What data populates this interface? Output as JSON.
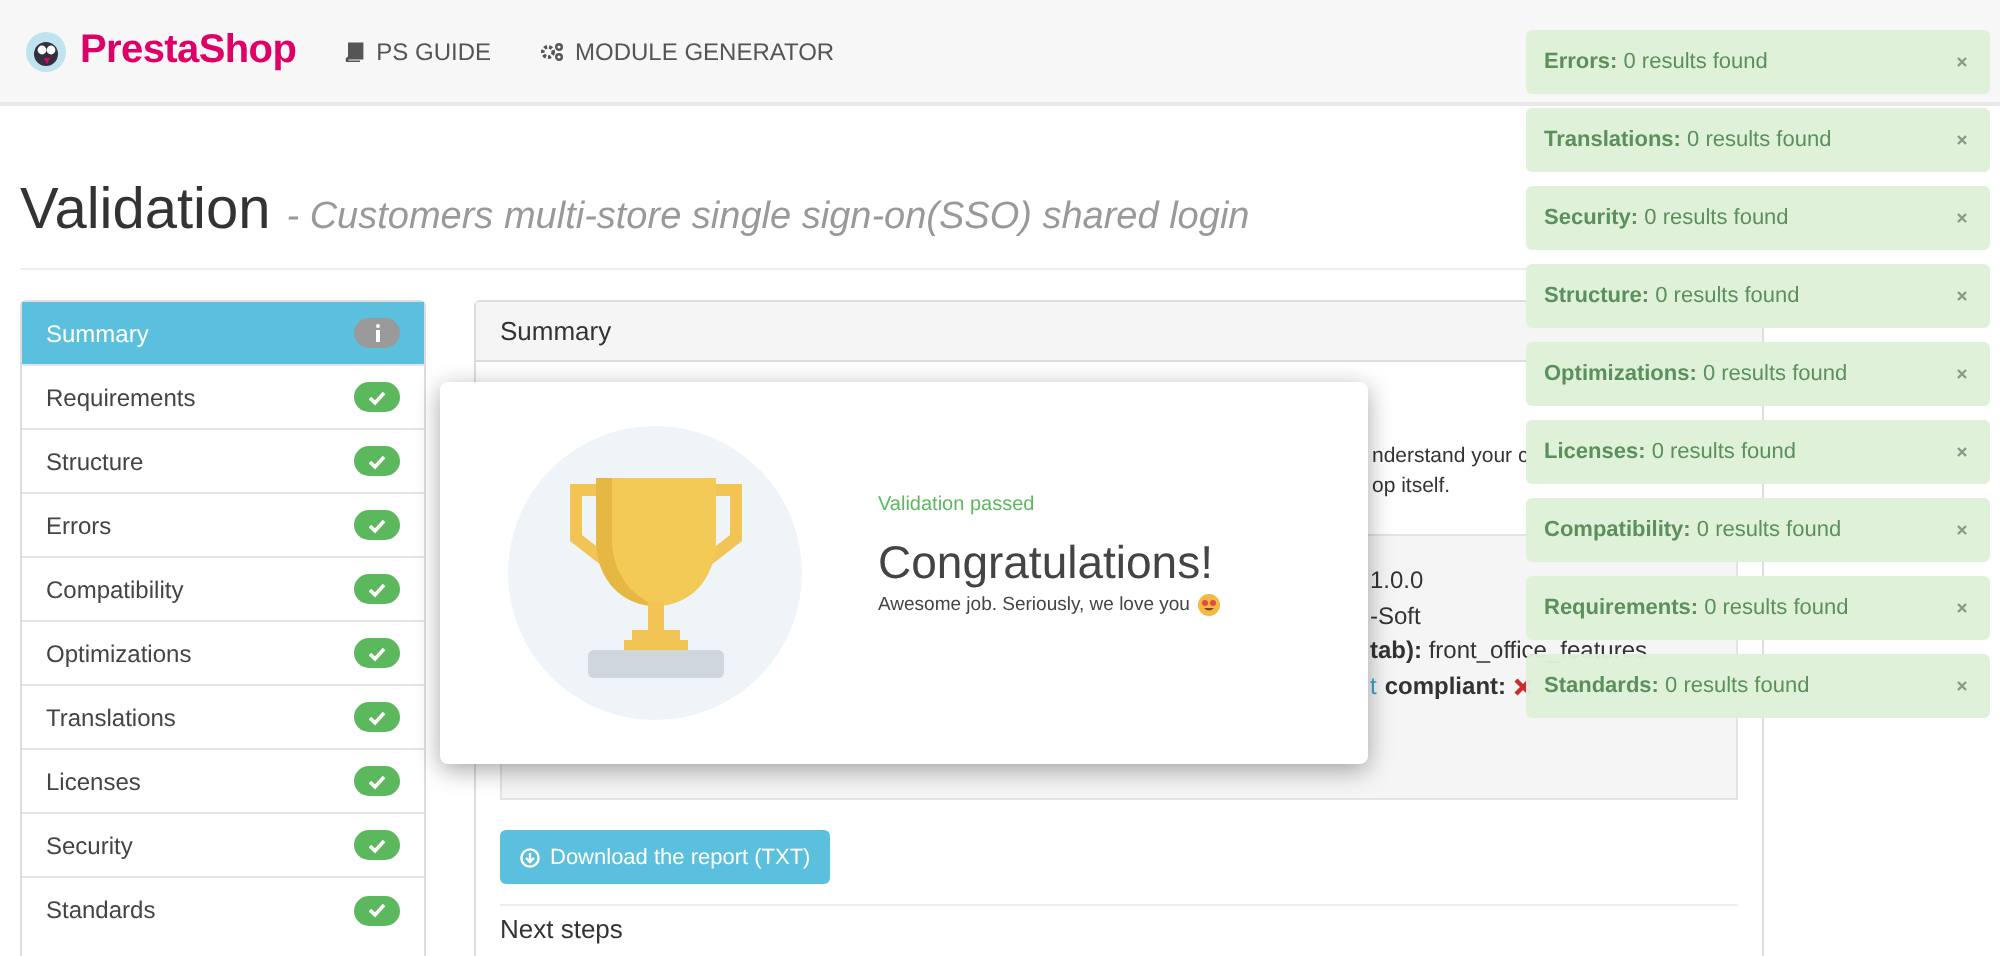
{
  "header": {
    "brand": "PrestaShop",
    "nav": [
      {
        "label": "PS GUIDE"
      },
      {
        "label": "MODULE GENERATOR"
      }
    ]
  },
  "title": "Validation",
  "subtitle": "- Customers multi-store single sign-on(SSO) shared login",
  "sidebar": {
    "items": [
      {
        "label": "Summary",
        "selected": true,
        "kind": "info"
      },
      {
        "label": "Requirements",
        "selected": false,
        "kind": "check"
      },
      {
        "label": "Structure",
        "selected": false,
        "kind": "check"
      },
      {
        "label": "Errors",
        "selected": false,
        "kind": "check"
      },
      {
        "label": "Compatibility",
        "selected": false,
        "kind": "check"
      },
      {
        "label": "Optimizations",
        "selected": false,
        "kind": "check"
      },
      {
        "label": "Translations",
        "selected": false,
        "kind": "check"
      },
      {
        "label": "Licenses",
        "selected": false,
        "kind": "check"
      },
      {
        "label": "Security",
        "selected": false,
        "kind": "check"
      },
      {
        "label": "Standards",
        "selected": false,
        "kind": "check"
      }
    ]
  },
  "panel": {
    "title": "Summary",
    "intro_lines": [
      "nderstand your c",
      "op itself."
    ],
    "details": [
      {
        "text": "1.0.0"
      },
      {
        "text": "-Soft"
      },
      {
        "text": "**tab):** front_office_features"
      },
      {
        "link": "t",
        "text": "**compliant:**",
        "passed": false
      }
    ],
    "download_button": "Download the report (TXT)",
    "next_heading": "Next steps"
  },
  "modal": {
    "status": "Validation passed",
    "heading": "Congratulations!",
    "message": "Awesome job. Seriously, we love you"
  },
  "toasts": [
    {
      "category": "Errors:",
      "text": "0 results found"
    },
    {
      "category": "Translations:",
      "text": "0 results found"
    },
    {
      "category": "Security:",
      "text": "0 results found"
    },
    {
      "category": "Structure:",
      "text": "0 results found"
    },
    {
      "category": "Optimizations:",
      "text": "0 results found"
    },
    {
      "category": "Licenses:",
      "text": "0 results found"
    },
    {
      "category": "Compatibility:",
      "text": "0 results found"
    },
    {
      "category": "Requirements:",
      "text": "0 results found"
    },
    {
      "category": "Standards:",
      "text": "0 results found"
    }
  ]
}
